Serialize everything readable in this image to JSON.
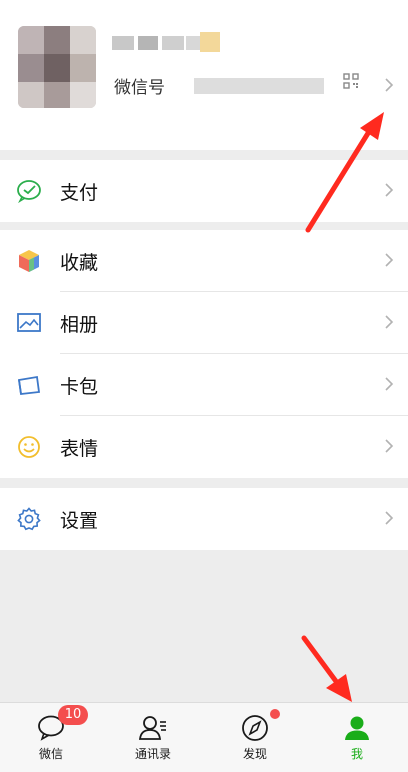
{
  "profile": {
    "wechat_id_label": "微信号"
  },
  "menu": {
    "pay": "支付",
    "favorites": "收藏",
    "album": "相册",
    "cards": "卡包",
    "stickers": "表情",
    "settings": "设置"
  },
  "tabs": [
    {
      "label": "微信",
      "badge": "10"
    },
    {
      "label": "通讯录"
    },
    {
      "label": "发现"
    },
    {
      "label": "我"
    }
  ],
  "colors": {
    "accent": "#1aad19",
    "badge": "#f44e4e",
    "arrow": "#ff2a1f"
  }
}
